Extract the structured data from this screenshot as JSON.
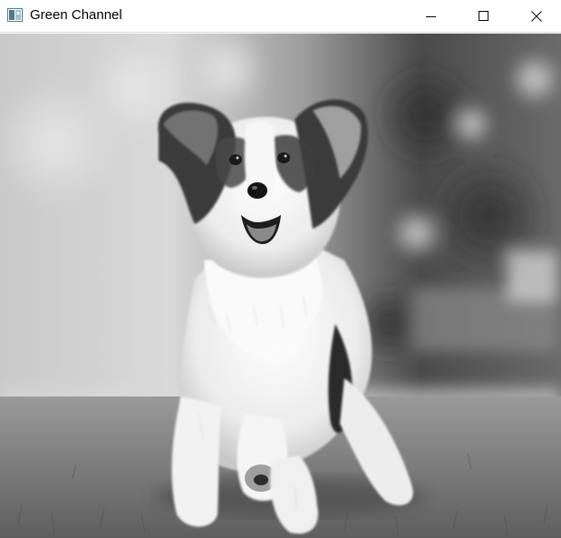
{
  "window": {
    "title": "Green Channel",
    "controls": {
      "minimize": "minimize",
      "maximize": "maximize",
      "close": "close"
    }
  },
  "image": {
    "subject": "dog-photo",
    "channel": "green",
    "colors": {
      "background_light": "#d8d8d8",
      "background_dark": "#3a3a3a",
      "grass": "#7a7a7a",
      "fur_light": "#f2f2f2",
      "fur_dark": "#2a2a2a"
    }
  }
}
